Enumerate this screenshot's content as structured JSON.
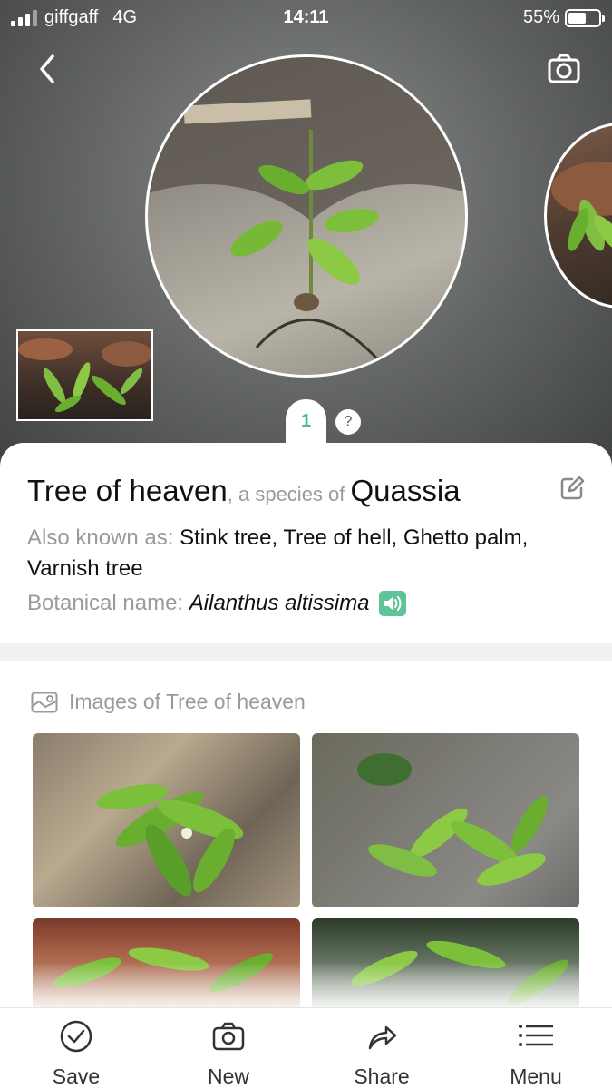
{
  "status_bar": {
    "carrier": "giffgaff",
    "network": "4G",
    "time": "14:11",
    "battery": "55%"
  },
  "hero": {
    "result_index": "1",
    "help": "?",
    "back_icon": "chevron-left-icon",
    "camera_icon": "camera-icon"
  },
  "card": {
    "common_name": "Tree of heaven",
    "species_of_text": ", a species of ",
    "genus": "Quassia",
    "aka_label": "Also known as: ",
    "aka_value": "Stink tree, Tree of hell, Ghetto palm, Varnish tree",
    "botanical_label": "Botanical name: ",
    "botanical_value": "Ailanthus altissima",
    "edit_icon": "edit-icon",
    "speaker_icon": "speaker-icon",
    "speaker_color": "#5fc39a"
  },
  "images": {
    "heading": "Images of Tree of heaven",
    "icon": "image-icon"
  },
  "tabbar": {
    "save": "Save",
    "new": "New",
    "share": "Share",
    "menu": "Menu"
  },
  "colors": {
    "accent": "#4fb891"
  }
}
